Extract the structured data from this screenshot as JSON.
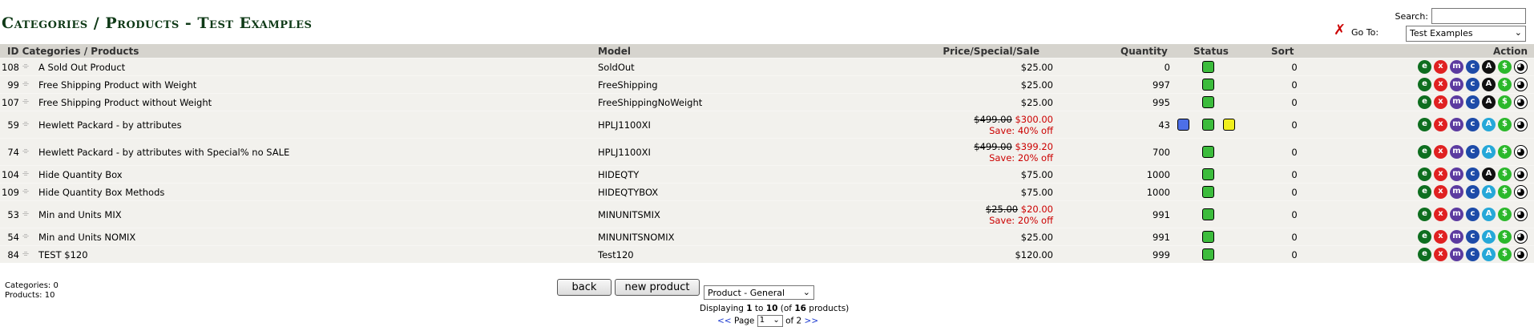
{
  "page_title": "Categories / Products - Test Examples",
  "search": {
    "label": "Search:",
    "value": ""
  },
  "goto": {
    "label": "Go To:",
    "selected": "Test Examples"
  },
  "columns": {
    "id_categories_products": "ID Categories / Products",
    "model": "Model",
    "price": "Price/Special/Sale",
    "quantity": "Quantity",
    "status": "Status",
    "sort": "Sort",
    "action": "Action"
  },
  "rows": [
    {
      "id": "108",
      "name": "A Sold Out Product",
      "model": "SoldOut",
      "price": "$25.00",
      "old_price": "",
      "special_price": "",
      "save": "",
      "quantity": "0",
      "sort": "0",
      "extra_status": false,
      "action_variant": "dark"
    },
    {
      "id": "99",
      "name": "Free Shipping Product with Weight",
      "model": "FreeShipping",
      "price": "$25.00",
      "old_price": "",
      "special_price": "",
      "save": "",
      "quantity": "997",
      "sort": "0",
      "extra_status": false,
      "action_variant": "dark"
    },
    {
      "id": "107",
      "name": "Free Shipping Product without Weight",
      "model": "FreeShippingNoWeight",
      "price": "$25.00",
      "old_price": "",
      "special_price": "",
      "save": "",
      "quantity": "995",
      "sort": "0",
      "extra_status": false,
      "action_variant": "dark"
    },
    {
      "id": "59",
      "name": "Hewlett Packard - by attributes",
      "model": "HPLJ1100XI",
      "price": "",
      "old_price": "$499.00",
      "special_price": "$300.00",
      "save": "Save: 40% off",
      "quantity": "43",
      "sort": "0",
      "extra_status": true,
      "action_variant": "cyan"
    },
    {
      "id": "74",
      "name": "Hewlett Packard - by attributes with Special% no SALE",
      "model": "HPLJ1100XI",
      "price": "",
      "old_price": "$499.00",
      "special_price": "$399.20",
      "save": "Save: 20% off",
      "quantity": "700",
      "sort": "0",
      "extra_status": false,
      "action_variant": "cyan"
    },
    {
      "id": "104",
      "name": "Hide Quantity Box",
      "model": "HIDEQTY",
      "price": "$75.00",
      "old_price": "",
      "special_price": "",
      "save": "",
      "quantity": "1000",
      "sort": "0",
      "extra_status": false,
      "action_variant": "dark"
    },
    {
      "id": "109",
      "name": "Hide Quantity Box Methods",
      "model": "HIDEQTYBOX",
      "price": "$75.00",
      "old_price": "",
      "special_price": "",
      "save": "",
      "quantity": "1000",
      "sort": "0",
      "extra_status": false,
      "action_variant": "cyan"
    },
    {
      "id": "53",
      "name": "Min and Units MIX",
      "model": "MINUNITSMIX",
      "price": "",
      "old_price": "$25.00",
      "special_price": "$20.00",
      "save": "Save: 20% off",
      "quantity": "991",
      "sort": "0",
      "extra_status": false,
      "action_variant": "cyan"
    },
    {
      "id": "54",
      "name": "Min and Units NOMIX",
      "model": "MINUNITSNOMIX",
      "price": "$25.00",
      "old_price": "",
      "special_price": "",
      "save": "",
      "quantity": "991",
      "sort": "0",
      "extra_status": false,
      "action_variant": "cyan"
    },
    {
      "id": "84",
      "name": "TEST $120",
      "model": "Test120",
      "price": "$120.00",
      "old_price": "",
      "special_price": "",
      "save": "",
      "quantity": "999",
      "sort": "0",
      "extra_status": false,
      "action_variant": "cyan"
    }
  ],
  "action_icons": {
    "edit": "e",
    "delete": "x",
    "move": "m",
    "copy": "c",
    "attributes": "A",
    "price_manager": "$",
    "metatags": "meta-icon"
  },
  "colors": {
    "status_green": "#3cbc3c",
    "status_blue": "#4d6fe8",
    "status_yellow": "#f0ef1e",
    "title": "#0f3a17",
    "sale_red": "#cc0000"
  },
  "footer": {
    "categories_label": "Categories: 0",
    "products_label": "Products: 10",
    "back_label": "back",
    "new_product_label": "new product",
    "product_type_selected": "Product - General",
    "displaying_pre": "Displaying ",
    "displaying_from": "1",
    "displaying_to_word": " to ",
    "displaying_to": "10",
    "displaying_of_word": " (of ",
    "displaying_total": "16",
    "displaying_post": " products)",
    "pager_prev": "<<",
    "pager_page_label": "Page",
    "pager_current": "1",
    "pager_of": "of 2",
    "pager_next": ">>"
  }
}
